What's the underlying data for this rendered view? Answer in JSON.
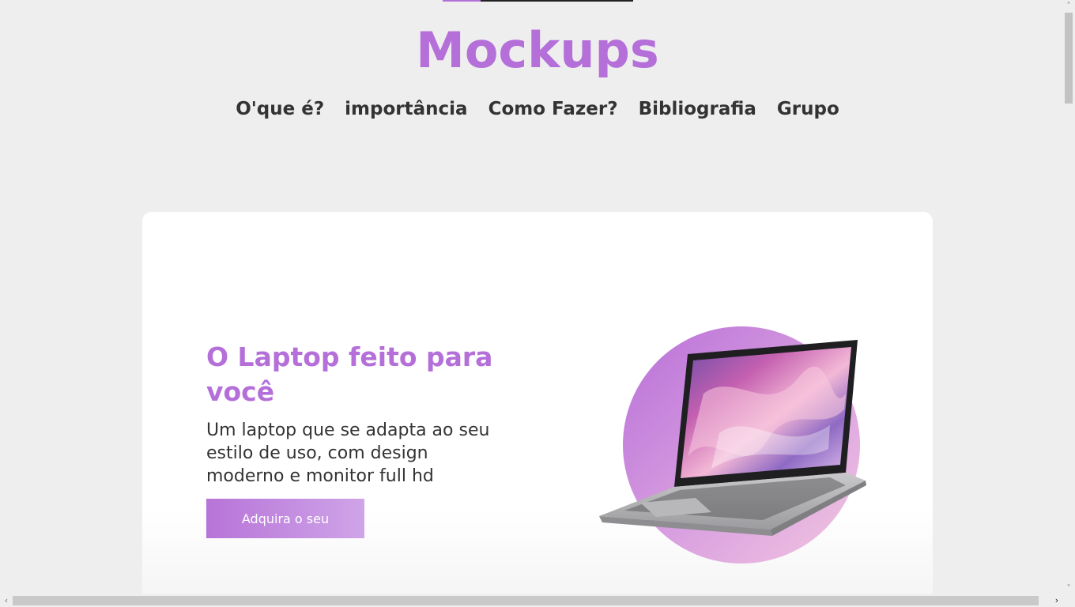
{
  "header": {
    "logo": "Mockups",
    "scroll_progress_percent": 20
  },
  "nav": {
    "items": [
      {
        "label": "O'que é?"
      },
      {
        "label": "importância"
      },
      {
        "label": "Como Fazer?"
      },
      {
        "label": "Bibliografia"
      },
      {
        "label": "Grupo"
      }
    ]
  },
  "hero": {
    "title": "O Laptop feito para você",
    "description": "Um laptop que se adapta ao seu estilo de uso, com design moderno e monitor full hd",
    "cta_label": "Adquira o seu",
    "image_icon": "laptop-product-image"
  },
  "colors": {
    "accent": "#b46fd9",
    "background": "#efeeef",
    "card": "#ffffff",
    "text": "#333333"
  },
  "scrollbars": {
    "up_arrow": "˄",
    "down_arrow": "˅",
    "left_arrow": "‹",
    "right_arrow": "›"
  }
}
